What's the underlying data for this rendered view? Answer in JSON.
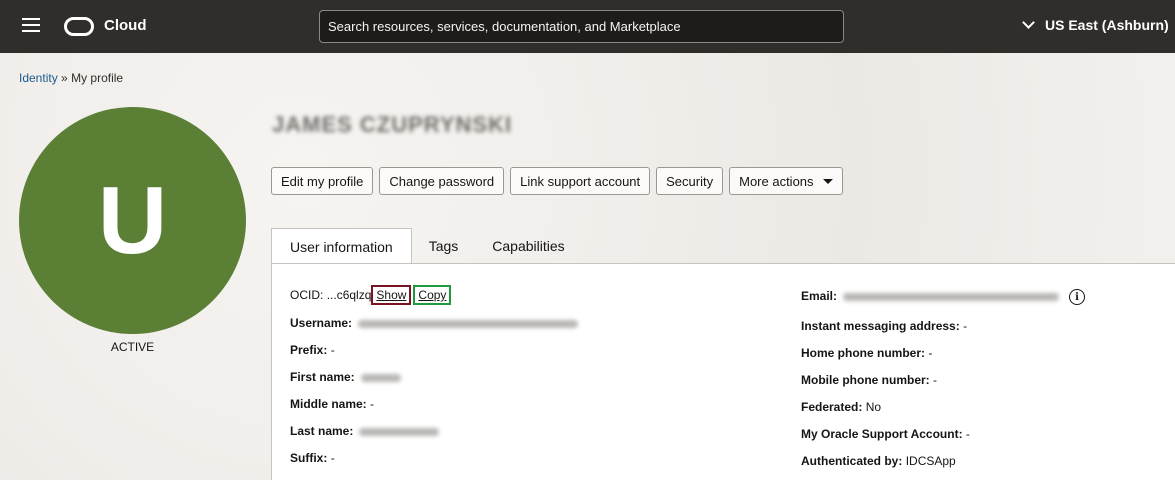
{
  "header": {
    "brand": "Cloud",
    "search_placeholder": "Search resources, services, documentation, and Marketplace",
    "region": "US East (Ashburn)"
  },
  "breadcrumb": {
    "parent": "Identity",
    "separator": "»",
    "current": "My profile"
  },
  "avatar": {
    "initial": "U",
    "status": "ACTIVE",
    "color": "#5a7f35"
  },
  "profile": {
    "name": "JAMES CZUPRYNSKI"
  },
  "actions": [
    {
      "label": "Edit my profile"
    },
    {
      "label": "Change password"
    },
    {
      "label": "Link support account"
    },
    {
      "label": "Security"
    },
    {
      "label": "More actions"
    }
  ],
  "tabs": [
    {
      "label": "User information"
    },
    {
      "label": "Tags"
    },
    {
      "label": "Capabilities"
    }
  ],
  "left_fields": {
    "ocid_label": "OCID:",
    "ocid_value": "...c6qlzq",
    "show": "Show",
    "copy": "Copy",
    "username_label": "Username:",
    "prefix_label": "Prefix:",
    "prefix_value": "-",
    "first_label": "First name:",
    "middle_label": "Middle name:",
    "middle_value": "-",
    "last_label": "Last name:",
    "suffix_label": "Suffix:",
    "suffix_value": "-"
  },
  "right_fields": {
    "email_label": "Email:",
    "im_label": "Instant messaging address:",
    "im_value": "-",
    "home_label": "Home phone number:",
    "home_value": "-",
    "mobile_label": "Mobile phone number:",
    "mobile_value": "-",
    "federated_label": "Federated:",
    "federated_value": "No",
    "support_label": "My Oracle Support Account:",
    "support_value": "-",
    "auth_label": "Authenticated by:",
    "auth_value": "IDCSApp"
  }
}
